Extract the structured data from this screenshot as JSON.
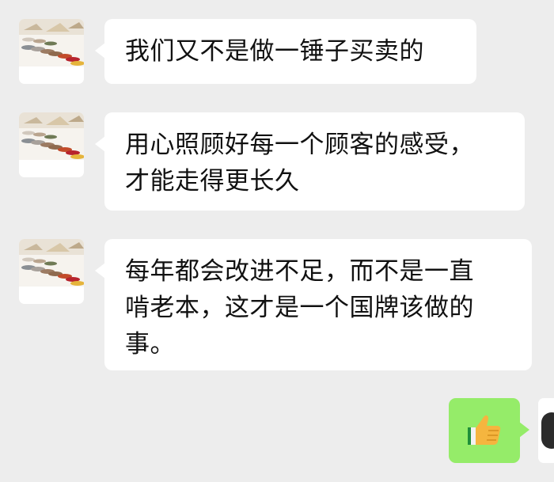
{
  "conversation": {
    "messages": [
      {
        "sender": "contact",
        "lines": [
          "我们又不是做一锤子买卖的"
        ]
      },
      {
        "sender": "contact",
        "lines": [
          "用心照顾好每一个顾客的感受，",
          "才能走得更长久"
        ]
      },
      {
        "sender": "contact",
        "lines": [
          "每年都会改进不足，而不是一直",
          "啃老本，这才是一个国牌该做的",
          "事。"
        ]
      }
    ],
    "sent_sticker": {
      "icon": "thumbs-up-icon"
    }
  },
  "colors": {
    "background": "#ededed",
    "incoming_bubble": "#ffffff",
    "outgoing_bubble": "#95ec69",
    "text": "#111111"
  }
}
